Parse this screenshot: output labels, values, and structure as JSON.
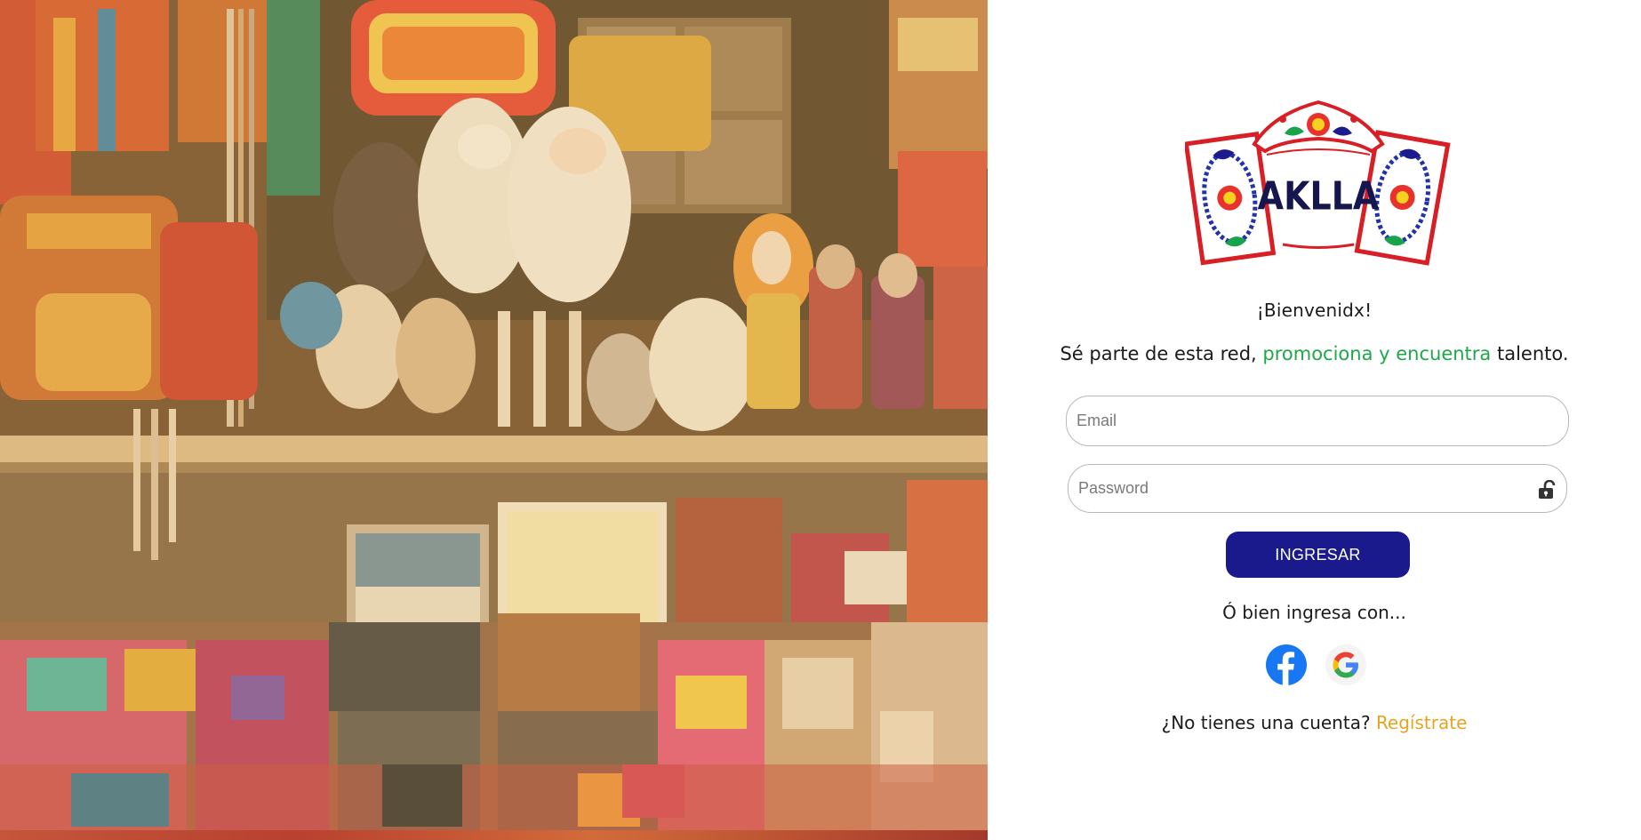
{
  "brand": {
    "logo_text": "AKLLA"
  },
  "welcome_text": "¡Bienvenidx!",
  "tagline": {
    "before": "Sé parte de esta red,",
    "accent": "promociona y encuentra",
    "after": "talento."
  },
  "form": {
    "email_placeholder": "Email",
    "email_value": "",
    "password_placeholder": "Password",
    "password_value": "",
    "password_toggle_icon": "unlock-icon",
    "submit_label": "INGRESAR"
  },
  "alt_login_text": "Ó bien ingresa con...",
  "social_providers": [
    {
      "name": "facebook",
      "icon": "facebook-icon"
    },
    {
      "name": "google",
      "icon": "google-icon"
    }
  ],
  "signup": {
    "prompt": "¿No tienes una cuenta?",
    "link_label": "Regístrate"
  },
  "colors": {
    "primary_button": "#1a1a8c",
    "accent_green": "#1fa84a",
    "link_orange": "#e8a421",
    "input_border": "#b9b9b9"
  }
}
